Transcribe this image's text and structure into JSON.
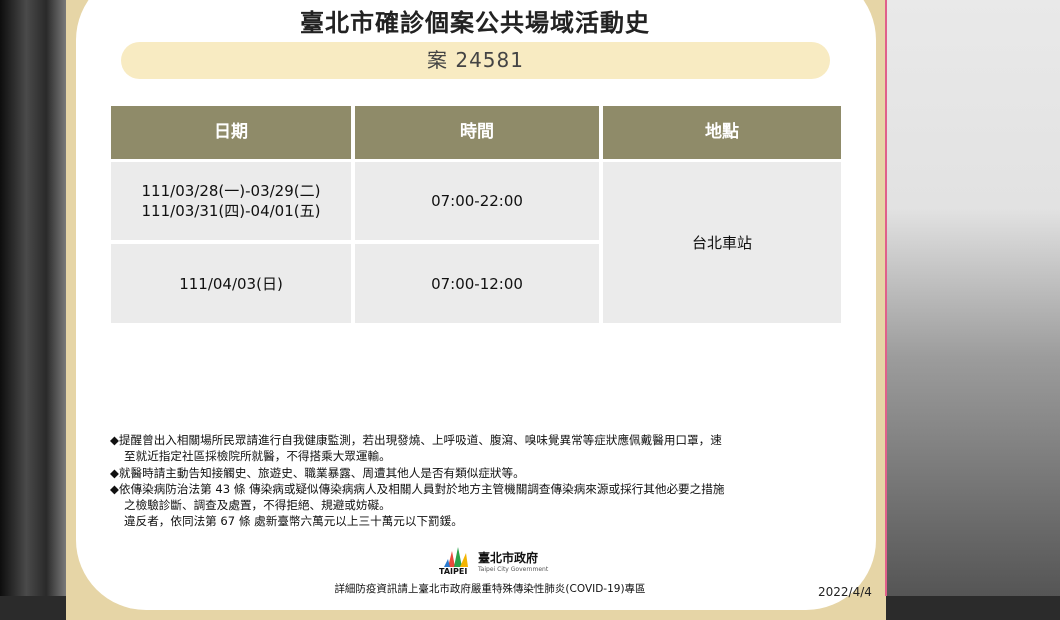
{
  "title": "臺北市確診個案公共場域活動史",
  "case_label": "案 24581",
  "table": {
    "headers": [
      "日期",
      "時間",
      "地點"
    ],
    "rows": [
      {
        "date_lines": [
          "111/03/28(一)-03/29(二)",
          "111/03/31(四)-04/01(五)"
        ],
        "time": "07:00-22:00"
      },
      {
        "date_lines": [
          "111/04/03(日)"
        ],
        "time": "07:00-12:00"
      }
    ],
    "location": "台北車站"
  },
  "notes": [
    "◆提醒曾出入相關場所民眾請進行自我健康監測，若出現發燒、上呼吸道、腹瀉、嗅味覺異常等症狀應佩戴醫用口罩，速",
    "至就近指定社區採檢院所就醫，不得搭乘大眾運輸。",
    "◆就醫時請主動告知接觸史、旅遊史、職業暴露、周遭其他人是否有類似症狀等。",
    "◆依傳染病防治法第 43 條 傳染病或疑似傳染病病人及相關人員對於地方主管機關調查傳染病來源或採行其他必要之措施",
    "之檢驗診斷、調查及處置，不得拒絕、規避或妨礙。",
    "違反者，依同法第 67 條 處新臺幣六萬元以上三十萬元以下罰鍰。"
  ],
  "logo": {
    "name": "臺北市政府",
    "sub": "Taipei City Government",
    "mark": "TAIPEI"
  },
  "footer": "詳細防疫資訊請上臺北市政府嚴重特殊傳染性肺炎(COVID-19)專區",
  "date": "2022/4/4",
  "colors": {
    "frame": "#e6d5a6",
    "pill": "#f8ebc2",
    "header": "#8f8b69",
    "cell": "#ebebeb"
  }
}
